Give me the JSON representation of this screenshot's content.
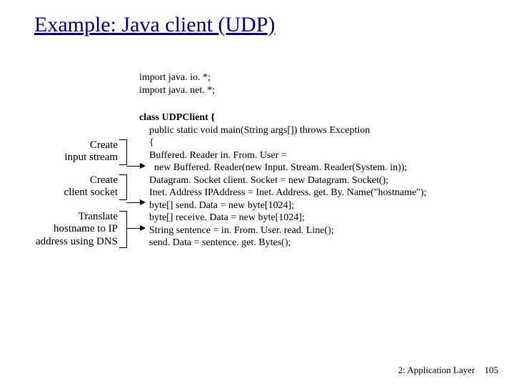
{
  "title": "Example: Java client (UDP)",
  "imports": {
    "line1": "import java. io. *;",
    "line2": "import java. net. *;"
  },
  "code": {
    "l1": "class UDPClient {",
    "l2": "    public static void main(String args[]) throws Exception",
    "l3": "    {",
    "l4": "",
    "l5": "    Buffered. Reader in. From. User =",
    "l6": "      new Buffered. Reader(new Input. Stream. Reader(System. in));",
    "l7": "",
    "l8": "    Datagram. Socket client. Socket = new Datagram. Socket();",
    "l9": "",
    "l10": "    Inet. Address IPAddress = Inet. Address. get. By. Name(\"hostname\");",
    "l11": "",
    "l12": "    byte[] send. Data = new byte[1024];",
    "l13": "    byte[] receive. Data = new byte[1024];",
    "l14": "",
    "l15": "    String sentence = in. From. User. read. Line();",
    "l16": "",
    "l17": "    send. Data = sentence. get. Bytes();"
  },
  "annotations": {
    "a1_l1": "Create",
    "a1_l2": "input stream",
    "a2_l1": "Create",
    "a2_l2": "client socket",
    "a3_l1": "Translate",
    "a3_l2": "hostname to IP",
    "a3_l3": "address using DNS"
  },
  "footer": {
    "chapter": "2: Application Layer",
    "page": "105"
  }
}
